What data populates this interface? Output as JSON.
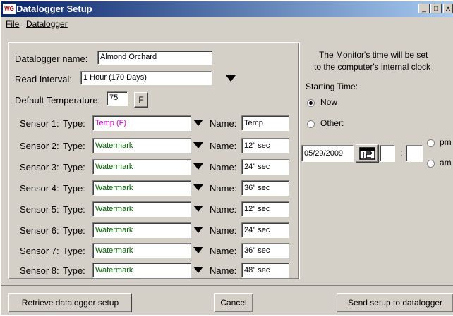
{
  "window": {
    "app_badge": "WG",
    "title": "Datalogger Setup",
    "min_glyph": "_",
    "max_glyph": "□",
    "close_glyph": "X"
  },
  "menu": {
    "file": "File",
    "datalogger": "Datalogger"
  },
  "form": {
    "name_label": "Datalogger name:",
    "name_value": "Almond Orchard",
    "interval_label": "Read Interval:",
    "interval_value": "1 Hour (170 Days)",
    "temp_label": "Default Temperature:",
    "temp_value": "75",
    "temp_unit_button": "F",
    "type_label": "Type:",
    "name_field_label": "Name:",
    "sensors": [
      {
        "label": "Sensor 1:",
        "type": "Temp (F)",
        "type_color": "#cc00cc",
        "name": "Temp"
      },
      {
        "label": "Sensor 2:",
        "type": "Watermark",
        "type_color": "#006400",
        "name": "12\" sec"
      },
      {
        "label": "Sensor 3:",
        "type": "Watermark",
        "type_color": "#006400",
        "name": "24\" sec"
      },
      {
        "label": "Sensor 4:",
        "type": "Watermark",
        "type_color": "#006400",
        "name": "36\" sec"
      },
      {
        "label": "Sensor 5:",
        "type": "Watermark",
        "type_color": "#006400",
        "name": "12\" sec"
      },
      {
        "label": "Sensor 6:",
        "type": "Watermark",
        "type_color": "#006400",
        "name": "24\" sec"
      },
      {
        "label": "Sensor 7:",
        "type": "Watermark",
        "type_color": "#006400",
        "name": "36\" sec"
      },
      {
        "label": "Sensor 8:",
        "type": "Watermark",
        "type_color": "#006400",
        "name": "48\" sec"
      }
    ]
  },
  "time": {
    "note_line1": "The Monitor's time will be set",
    "note_line2": "to the computer's internal clock",
    "starting_label": "Starting Time:",
    "now_label": "Now",
    "other_label": "Other:",
    "selected": "now",
    "date_value": "05/29/2009",
    "colon": ":",
    "pm_label": "pm",
    "am_label": "am"
  },
  "buttons": {
    "retrieve": "Retrieve datalogger setup",
    "cancel": "Cancel",
    "send": "Send setup to datalogger"
  }
}
